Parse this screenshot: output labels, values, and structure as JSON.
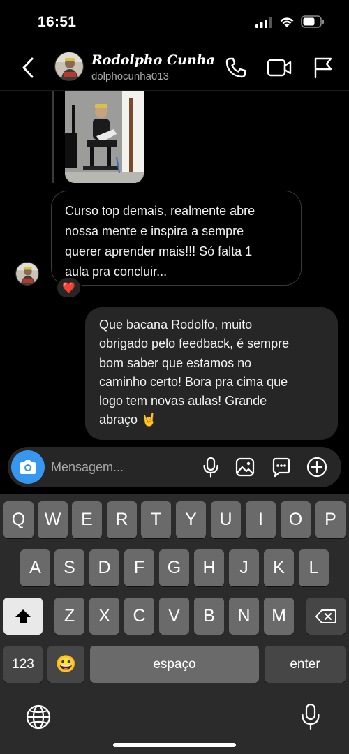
{
  "status_bar": {
    "time": "16:51"
  },
  "header": {
    "contact_name": "Rodolpho Cunha",
    "username": "dolphocunha013"
  },
  "messages": {
    "received": {
      "lines": [
        "Curso top demais, realmente abre",
        "nossa mente e inspira a sempre",
        "querer aprender mais!!! Só falta 1",
        "aula pra concluir..."
      ],
      "reaction": "❤️"
    },
    "sent": {
      "lines": [
        "Que bacana Rodolfo, muito",
        "obrigado pelo feedback, é sempre",
        "bom saber que estamos no",
        "caminho certo! Bora pra cima que",
        "logo tem novas aulas! Grande",
        "abraço 🤘"
      ]
    }
  },
  "composer": {
    "placeholder": "Mensagem..."
  },
  "keyboard": {
    "row1": [
      "Q",
      "W",
      "E",
      "R",
      "T",
      "Y",
      "U",
      "I",
      "O",
      "P"
    ],
    "row2": [
      "A",
      "S",
      "D",
      "F",
      "G",
      "H",
      "J",
      "K",
      "L"
    ],
    "row3": [
      "Z",
      "X",
      "C",
      "V",
      "B",
      "N",
      "M"
    ],
    "numbers_label": "123",
    "emoji": "😀",
    "space_label": "espaço",
    "enter_label": "enter"
  },
  "colors": {
    "accent": "#3797f0",
    "bubble_out": "#262626",
    "keyboard_bg": "#2b2b2b"
  }
}
